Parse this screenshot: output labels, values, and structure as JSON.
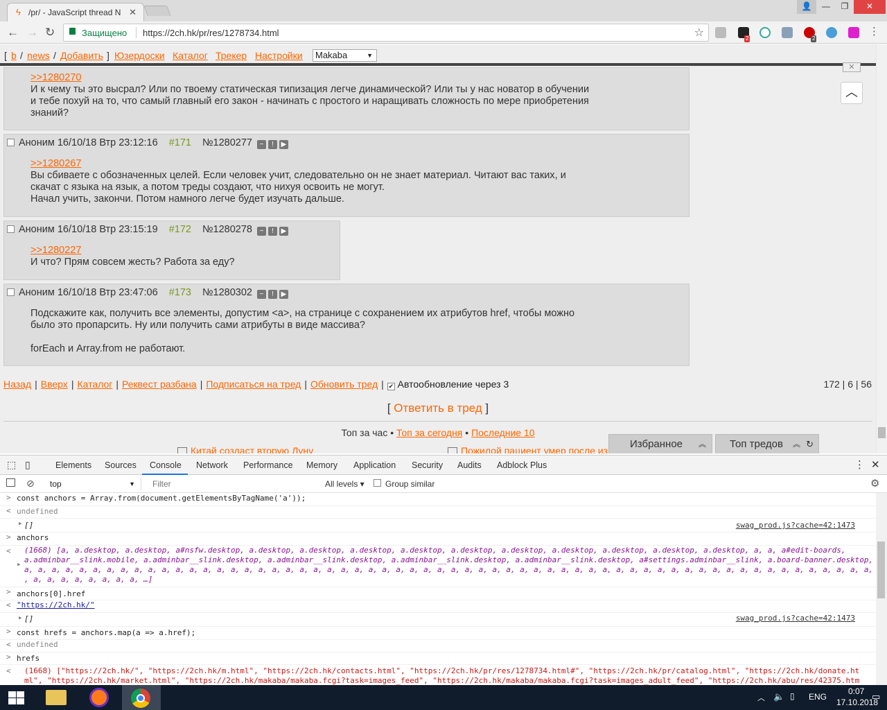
{
  "browser": {
    "tab_title": "/pr/ - JavaScript thread N",
    "tab_close": "✕",
    "secure_label": "Защищено",
    "url": "https://2ch.hk/pr/res/1278734.html",
    "ext_badge_1": "2",
    "ext_badge_2": "2",
    "window_controls": {
      "minimize": "—",
      "restore": "❐",
      "close": "✕"
    }
  },
  "adminbar": {
    "bracket_open": "[",
    "b": "b",
    "news": "news",
    "add": "Добавить",
    "userboards": "Юзердоски",
    "catalog": "Каталог",
    "tracker": "Трекер",
    "settings": "Настройки",
    "style_select": "Makaba"
  },
  "posts": [
    {
      "reply_link": ">>1280270",
      "lines": [
        "И к чему ты это высрал? Или по твоему статическая типизация легче динамической? Или ты у нас новатор в обучении",
        "и тебе похуй на то, что самый главный его закон - начинать с простого и наращивать сложность по мере приобретения",
        "знаний?"
      ]
    },
    {
      "header": "Аноним 16/10/18 Втр 23:12:16",
      "num": "#171",
      "id": "№1280277",
      "reply_link": ">>1280267",
      "lines": [
        "Вы сбиваете с обозначенных целей. Если человек учит, следовательно он не знает материал. Читают вас таких, и",
        "скачат с языка на язык, а потом треды создают, что нихуя освоить не могут.",
        "Начал учить, закончи. Потом намного легче будет изучать дальше."
      ]
    },
    {
      "header": "Аноним 16/10/18 Втр 23:15:19",
      "num": "#172",
      "id": "№1280278",
      "reply_link": ">>1280227",
      "lines": [
        "И что? Прям совсем жесть? Работа за еду?"
      ]
    },
    {
      "header": "Аноним 16/10/18 Втр 23:47:06",
      "num": "#173",
      "id": "№1280302",
      "lines": [
        "Подскажите как, получить все элементы, допустим <a>, на странице с сохранением их атрибутов href, чтобы можно",
        "было это пропарсить. Ну или получить сами атрибуты в виде массива?",
        "",
        "forEach и Array.from не работают."
      ]
    }
  ],
  "bottomnav": {
    "back": "Назад",
    "up": "Вверх",
    "catalog": "Каталог",
    "request_ban": "Реквест разбана",
    "subscribe": "Подписаться на тред",
    "refresh": "Обновить тред",
    "autoupdate": "Автообновление через 3",
    "stats": "172 | 6 | 56"
  },
  "reply_thread": "Ответить в тред",
  "top": {
    "hour": "Топ за час",
    "today": "Топ за сегодня",
    "last10": "Последние 10"
  },
  "news": {
    "item1": "Китай создаст вторую Луну",
    "item2": "Пожилой пациент умер после из"
  },
  "panels": {
    "favorites": "Избранное",
    "top_threads": "Топ тредов"
  },
  "devtools": {
    "tabs": [
      "Elements",
      "Sources",
      "Console",
      "Network",
      "Performance",
      "Memory",
      "Application",
      "Security",
      "Audits",
      "Adblock Plus"
    ],
    "context": "top",
    "filter_placeholder": "Filter",
    "levels": "All levels ▾",
    "group_similar": "Group similar"
  },
  "console": {
    "l1": "const anchors = Array.from(document.getElementsByTagName('a'));",
    "l2": "undefined",
    "l3": "[]",
    "src": "swag_prod.js?cache=42:1473",
    "l4": "anchors",
    "l5a": "(1668) [a, a.desktop, a.desktop, a#nsfw.desktop, a.desktop, a.desktop, a.desktop, a.desktop, a.desktop, a.desktop, a.desktop, a.desktop, a.desktop, a.desktop, a, a, a#edit-boards,",
    "l5b": "a.adminbar__slink.mobile, a.adminbar__slink.desktop, a.adminbar__slink.desktop, a.adminbar__slink.desktop, a.adminbar__slink.desktop, a#settings.adminbar__slink, a.board-banner.desktop, a, a, a, a, a, a, a, a,",
    "l5c": "a, a, a, a, a, a, a, a, a, a, a, a, a, a, a, a, a, a, a, a, a, a, a, a, a, a, a, a, a, a, a, a, a, a, a, a, a, a, a, a, a, a, a, a, a, a, a, a, a, a, a, a, a, a, a, a, a, a, a, a, a, a, a, a, a,",
    "l5d": ", a, a, a, a, a, a, a, a, …]",
    "l6": "anchors[0].href",
    "l7": "\"https://2ch.hk/\"",
    "l8": "const hrefs = anchors.map(a => a.href);",
    "l9": "undefined",
    "l10": "hrefs",
    "l11a": "(1668) [\"https://2ch.hk/\", \"https://2ch.hk/m.html\", \"https://2ch.hk/contacts.html\", \"https://2ch.hk/pr/res/1278734.html#\", \"https://2ch.hk/pr/catalog.html\", \"https://2ch.hk/donate.ht",
    "l11b": "ml\", \"https://2ch.hk/market.html\", \"https://2ch.hk/makaba/makaba.fcgi?task=images_feed\", \"https://2ch.hk/makaba/makaba.fcgi?task=images_adult_feed\", \"https://2ch.hk/abu/res/42375.htm"
  },
  "taskbar": {
    "lang": "ENG",
    "time": "0:07",
    "date": "17.10.2018"
  }
}
